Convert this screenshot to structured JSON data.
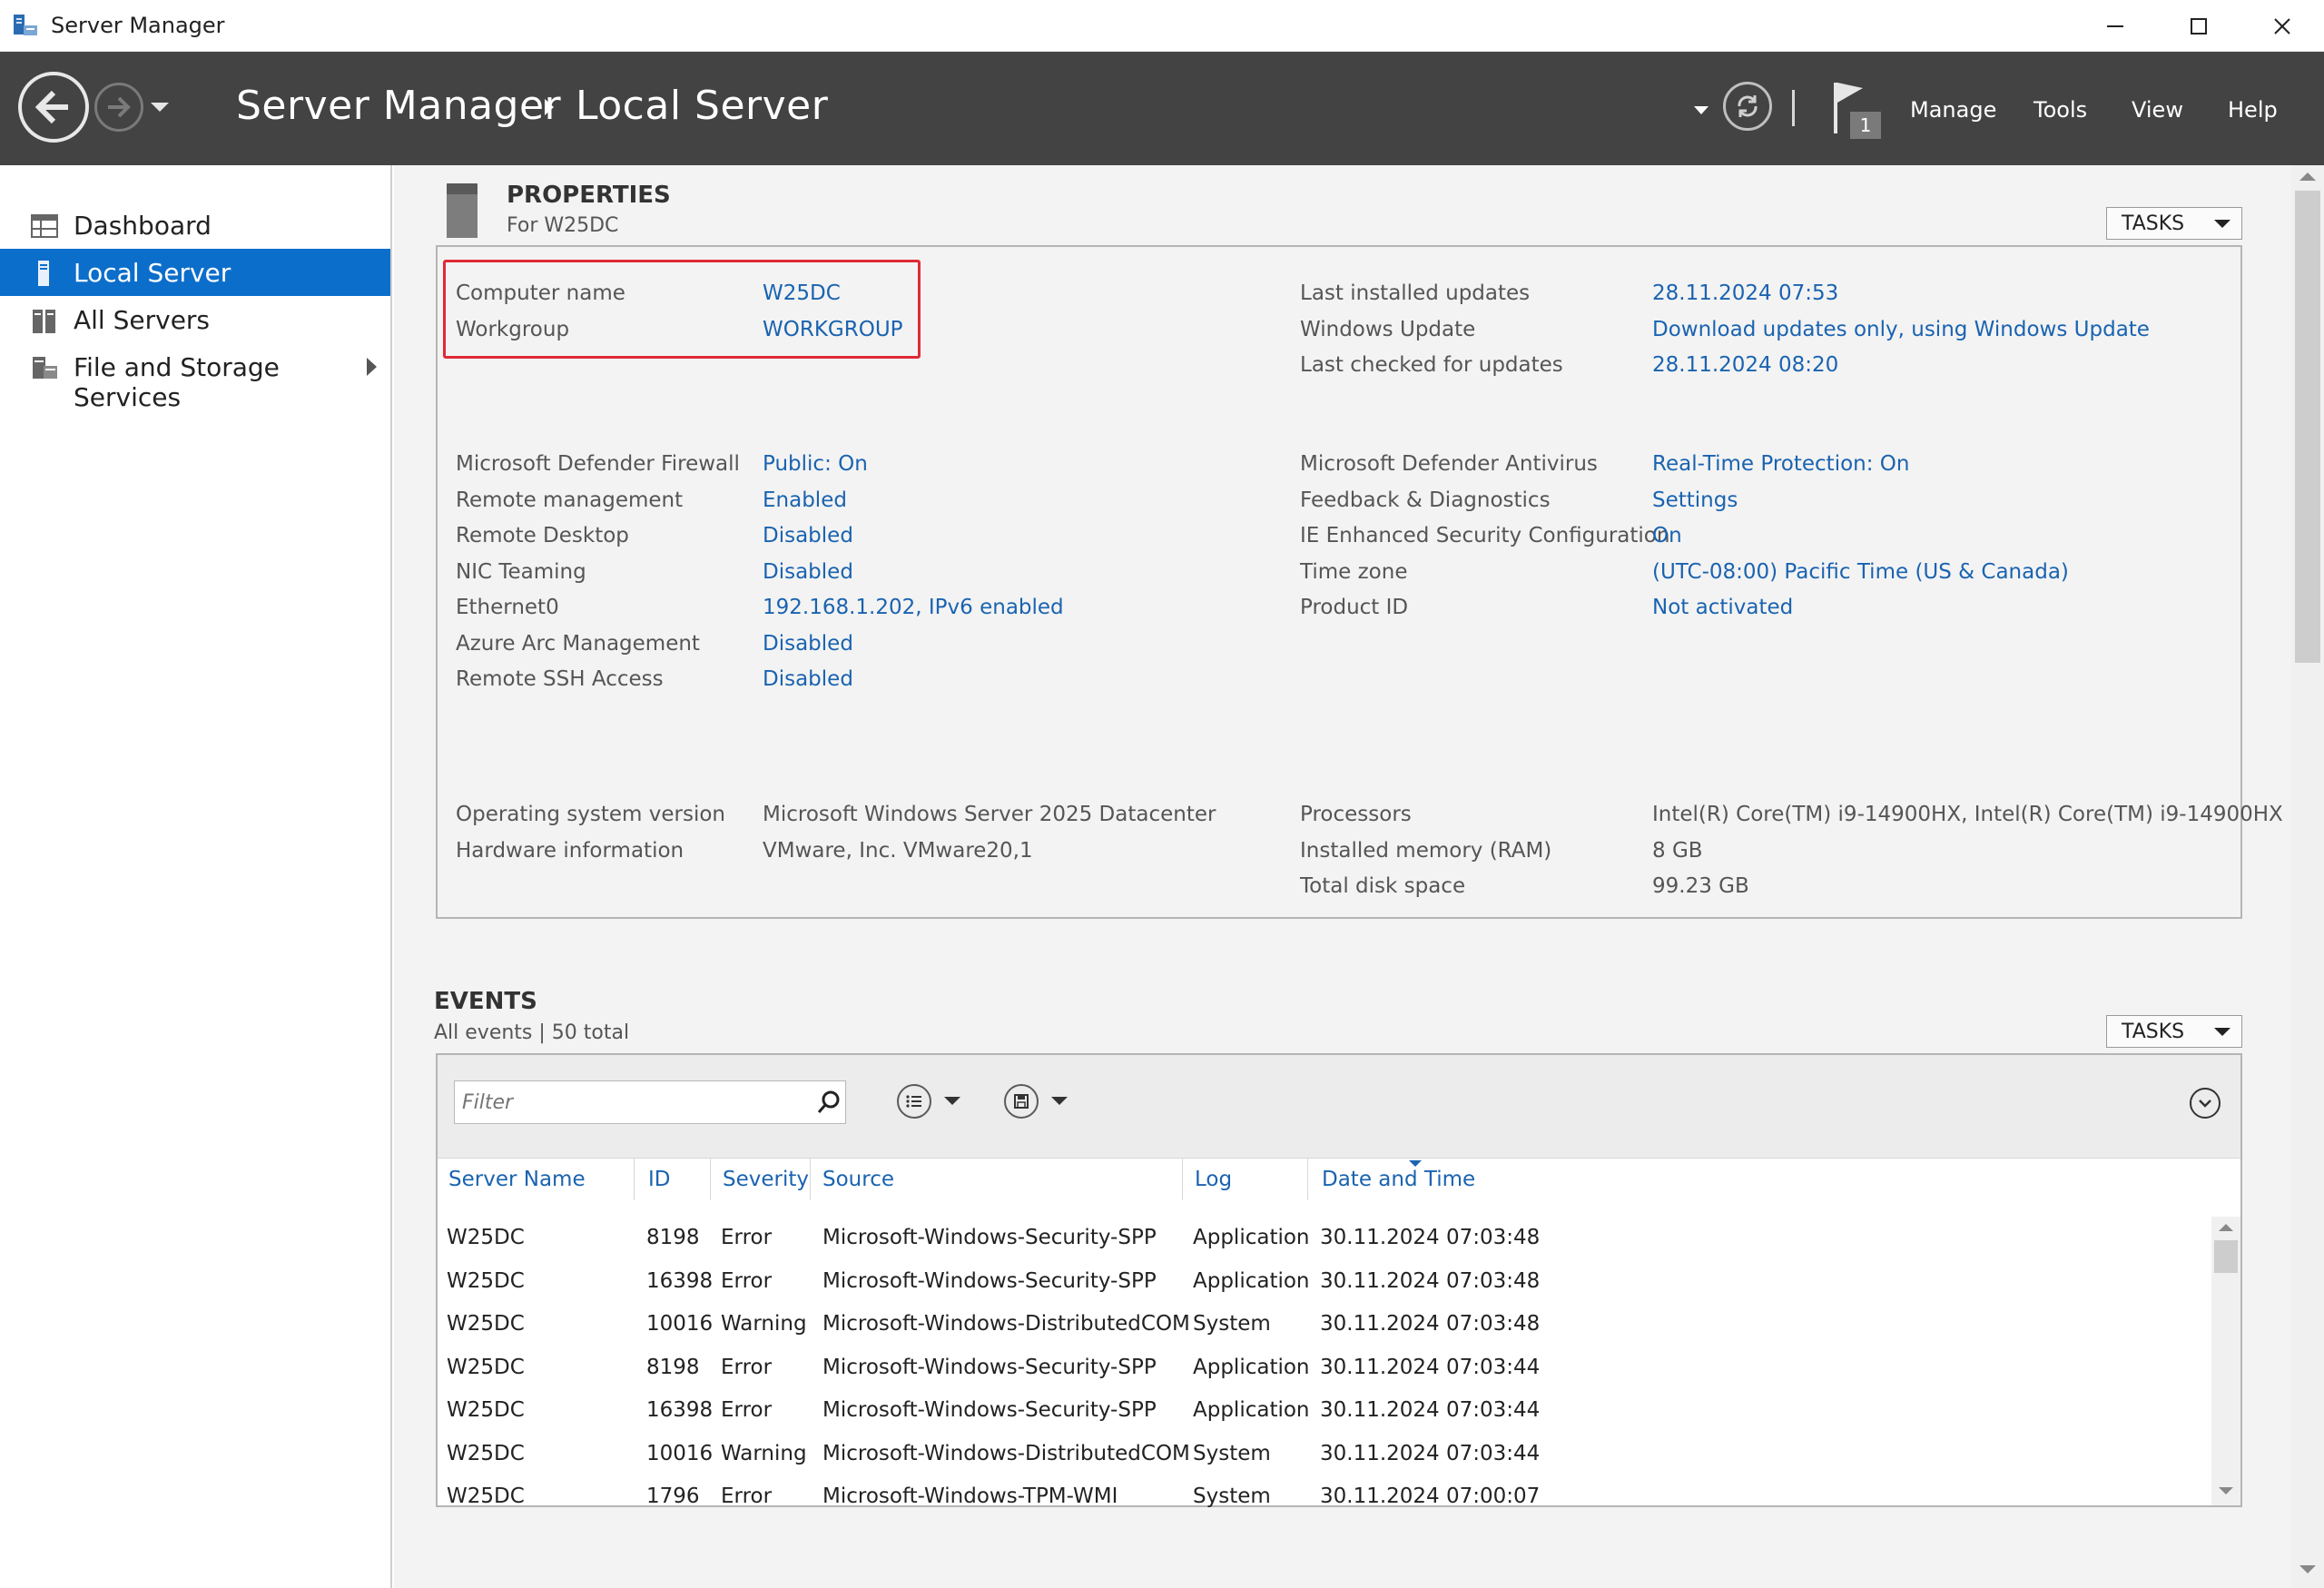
{
  "window": {
    "title": "Server Manager"
  },
  "header": {
    "breadcrumb_root": "Server Manager",
    "breadcrumb_current": "Local Server",
    "notification_count": "1",
    "menu": [
      "Manage",
      "Tools",
      "View",
      "Help"
    ]
  },
  "sidebar": {
    "items": [
      {
        "label": "Dashboard",
        "icon": "dashboard-icon",
        "selected": false
      },
      {
        "label": "Local Server",
        "icon": "server-icon",
        "selected": true
      },
      {
        "label": "All Servers",
        "icon": "servers-icon",
        "selected": false
      },
      {
        "label": "File and Storage Services",
        "icon": "file-storage-icon",
        "selected": false
      }
    ]
  },
  "properties": {
    "title": "PROPERTIES",
    "subtitle": "For W25DC",
    "tasks_label": "TASKS",
    "left_group1": [
      {
        "label": "Computer name",
        "value": "W25DC"
      },
      {
        "label": "Workgroup",
        "value": "WORKGROUP"
      }
    ],
    "right_group1": [
      {
        "label": "Last installed updates",
        "value": "28.11.2024 07:53"
      },
      {
        "label": "Windows Update",
        "value": "Download updates only, using Windows Update"
      },
      {
        "label": "Last checked for updates",
        "value": "28.11.2024 08:20"
      }
    ],
    "left_group2": [
      {
        "label": "Microsoft Defender Firewall",
        "value": "Public: On"
      },
      {
        "label": "Remote management",
        "value": "Enabled"
      },
      {
        "label": "Remote Desktop",
        "value": "Disabled"
      },
      {
        "label": "NIC Teaming",
        "value": "Disabled"
      },
      {
        "label": "Ethernet0",
        "value": "192.168.1.202, IPv6 enabled"
      },
      {
        "label": "Azure Arc Management",
        "value": "Disabled"
      },
      {
        "label": "Remote SSH Access",
        "value": "Disabled"
      }
    ],
    "right_group2": [
      {
        "label": "Microsoft Defender Antivirus",
        "value": "Real-Time Protection: On"
      },
      {
        "label": "Feedback & Diagnostics",
        "value": "Settings"
      },
      {
        "label": "IE Enhanced Security Configuration",
        "value": "On"
      },
      {
        "label": "Time zone",
        "value": "(UTC-08:00) Pacific Time (US & Canada)"
      },
      {
        "label": "Product ID",
        "value": "Not activated"
      }
    ],
    "left_group3": [
      {
        "label": "Operating system version",
        "value": "Microsoft Windows Server 2025 Datacenter"
      },
      {
        "label": "Hardware information",
        "value": "VMware, Inc. VMware20,1"
      }
    ],
    "right_group3": [
      {
        "label": "Processors",
        "value": "Intel(R) Core(TM) i9-14900HX, Intel(R) Core(TM) i9-14900HX"
      },
      {
        "label": "Installed memory (RAM)",
        "value": "8 GB"
      },
      {
        "label": "Total disk space",
        "value": "99.23 GB"
      }
    ]
  },
  "events": {
    "title": "EVENTS",
    "subtitle": "All events | 50 total",
    "tasks_label": "TASKS",
    "filter_placeholder": "Filter",
    "columns": [
      "Server Name",
      "ID",
      "Severity",
      "Source",
      "Log",
      "Date and Time"
    ],
    "rows": [
      [
        "W25DC",
        "8198",
        "Error",
        "Microsoft-Windows-Security-SPP",
        "Application",
        "30.11.2024 07:03:48"
      ],
      [
        "W25DC",
        "16398",
        "Error",
        "Microsoft-Windows-Security-SPP",
        "Application",
        "30.11.2024 07:03:48"
      ],
      [
        "W25DC",
        "10016",
        "Warning",
        "Microsoft-Windows-DistributedCOM",
        "System",
        "30.11.2024 07:03:48"
      ],
      [
        "W25DC",
        "8198",
        "Error",
        "Microsoft-Windows-Security-SPP",
        "Application",
        "30.11.2024 07:03:44"
      ],
      [
        "W25DC",
        "16398",
        "Error",
        "Microsoft-Windows-Security-SPP",
        "Application",
        "30.11.2024 07:03:44"
      ],
      [
        "W25DC",
        "10016",
        "Warning",
        "Microsoft-Windows-DistributedCOM",
        "System",
        "30.11.2024 07:03:44"
      ],
      [
        "W25DC",
        "1796",
        "Error",
        "Microsoft-Windows-TPM-WMI",
        "System",
        "30.11.2024 07:00:07"
      ]
    ]
  },
  "colors": {
    "header_bg": "#434343",
    "selected_nav": "#0c6ecb",
    "link": "#1a63b0",
    "highlight_box": "#e02a36"
  }
}
